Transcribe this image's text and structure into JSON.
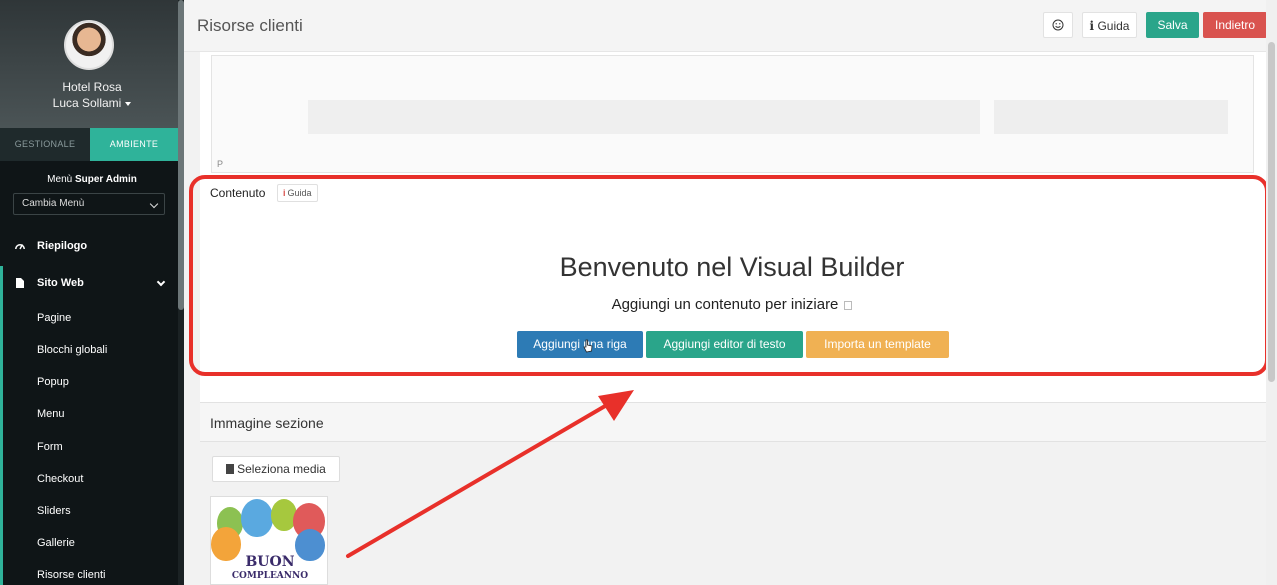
{
  "sidebar": {
    "hotel_name": "Hotel Rosa",
    "user_name": "Luca Sollami",
    "tabs": {
      "gestionale": "GESTIONALE",
      "ambiente": "AMBIENTE"
    },
    "menu_label_prefix": "Menù",
    "menu_label_bold": "Super Admin",
    "menu_select_value": "Cambia Menù",
    "items": [
      {
        "label": "Riepilogo",
        "icon": "dashboard-icon"
      },
      {
        "label": "Sito Web",
        "icon": "file-icon"
      }
    ],
    "sub_items": [
      "Pagine",
      "Blocchi globali",
      "Popup",
      "Menu",
      "Form",
      "Checkout",
      "Sliders",
      "Gallerie",
      "Risorse clienti"
    ]
  },
  "topbar": {
    "title": "Risorse clienti",
    "emoji_icon": "smiley-icon",
    "guida_label": "Guida",
    "salva_label": "Salva",
    "indietro_label": "Indietro"
  },
  "editor": {
    "p_label": "P",
    "contenuto_label": "Contenuto",
    "guida_chip": "Guida",
    "welcome_title": "Benvenuto nel Visual Builder",
    "welcome_subtitle": "Aggiungi un contenuto per iniziare",
    "actions": {
      "add_row": "Aggiungi una riga",
      "add_text_editor": "Aggiungi editor di testo",
      "import_template": "Importa un template"
    }
  },
  "image_section": {
    "title": "Immagine sezione",
    "select_media": "Seleziona media",
    "thumb_line1": "BUON",
    "thumb_line2": "COMPLEANNO"
  },
  "colors": {
    "sidebar_bg": "#0f1517",
    "accent_teal": "#2aa58a",
    "danger_red": "#d9534f",
    "primary_blue": "#2d7bb5",
    "warning_orange": "#f0b153",
    "highlight_red": "#e8302a"
  }
}
